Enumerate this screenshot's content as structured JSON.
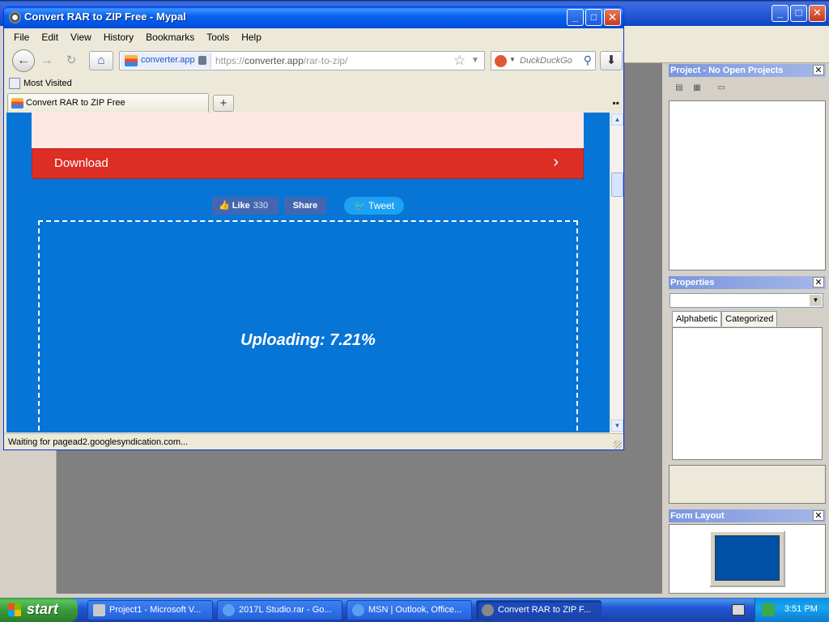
{
  "browser": {
    "title": "Convert RAR to ZIP Free - Mypal",
    "menu": [
      "File",
      "Edit",
      "View",
      "History",
      "Bookmarks",
      "Tools",
      "Help"
    ],
    "url_host": "converter.app",
    "url_prefix": "https://",
    "url_domain": "converter.app",
    "url_path": "/rar-to-zip/",
    "search_placeholder": "DuckDuckGo",
    "bookmark_label": "Most Visited",
    "tab_label": "Convert RAR to ZIP Free",
    "status": "Waiting for pagead2.googlesyndication.com...",
    "icons": {
      "back": "←",
      "forward": "→",
      "reload": "↻",
      "home": "⌂",
      "star": "☆",
      "search": "⚲",
      "download": "⬇",
      "plus": "+",
      "tab_list": "▪▪"
    }
  },
  "page": {
    "download_label": "Download",
    "download_chevron": "›",
    "like_label": "Like",
    "like_count": "330",
    "share_label": "Share",
    "tweet_label": "Tweet",
    "upload_status": "Uploading: 7.21%",
    "upload_progress_percent": 7.21
  },
  "ide": {
    "project_title": "Project - No Open Projects",
    "properties_title": "Properties",
    "tab_alphabetic": "Alphabetic",
    "tab_categorized": "Categorized",
    "form_layout_title": "Form Layout"
  },
  "taskbar": {
    "start_label": "start",
    "tasks": [
      "Project1 - Microsoft V...",
      "2017L Studio.rar - Go...",
      "MSN | Outlook, Office...",
      "Convert RAR to ZIP F..."
    ],
    "clock": "3:51 PM"
  },
  "colors": {
    "page_blue": "#0775d6",
    "download_red": "#dc2e24",
    "facebook_blue": "#4267b2",
    "twitter_blue": "#1da1f2"
  }
}
